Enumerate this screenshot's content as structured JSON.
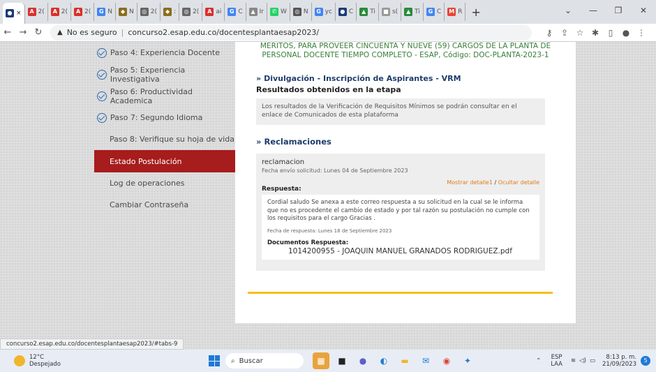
{
  "browser": {
    "tabs": [
      "2(",
      "2(",
      "2(",
      "N",
      "N",
      "2(",
      ":",
      "2(",
      "ai",
      "C",
      "Ir",
      "W",
      "N",
      "yc",
      "C",
      "Ti",
      "s(",
      "Ti",
      "C",
      "R"
    ],
    "new_tab": "+",
    "address": {
      "security": "No es seguro",
      "url": "concurso2.esap.edu.co/docentesplantaesap2023/"
    }
  },
  "sidebar": {
    "items": [
      {
        "label": "Paso 4: Experiencia Docente",
        "done": true
      },
      {
        "label": "Paso 5: Experiencia Investigativa",
        "done": true
      },
      {
        "label": "Paso 6: Productividad Academica",
        "done": true
      },
      {
        "label": "Paso 7: Segundo Idioma",
        "done": true
      },
      {
        "label": "Paso 8: Verifique su hoja de vida",
        "done": false
      },
      {
        "label": "Estado Postulación",
        "done": false,
        "active": true
      },
      {
        "label": "Log de operaciones",
        "done": false
      },
      {
        "label": "Cambiar Contraseña",
        "done": false
      }
    ]
  },
  "main": {
    "intro_line1": "MERITOS, PARA PROVEER CINCUENTA Y NUEVE (59) CARGOS DE LA PLANTA DE",
    "intro_line2": "PERSONAL DOCENTE TIEMPO COMPLETO - ESAP, Código: DOC-PLANTA-2023-1",
    "divulgacion_title": "Divulgación - Inscripción de Aspirantes - VRM",
    "resultados_title": "Resultados obtenidos en la etapa",
    "resultados_text": "Los resultados de la Verificación de Requisitos Mínimos se podrán consultar en el enlace de Comunicados de esta plataforma",
    "reclamaciones_title": "Reclamaciones",
    "reclamacion": {
      "name": "reclamacion",
      "date": "Fecha envío solicitud:  Lunes 04 de Septiembre 2023",
      "show_detail": "Mostrar detalle1",
      "separator": "/",
      "hide_detail": "Ocultar detalle",
      "response_label": "Respuesta:",
      "response_text": "Cordial saludo Se anexa a este correo respuesta a su solicitud en la cual se le informa que no es procedente el cambio de estado y por tal razón su postulación no cumple con los requisitos para el cargo Gracias .",
      "response_date": "Fecha de respuesta:  Lunes 18 de Septiembre 2023",
      "docs_label": "Documentos Respuesta:",
      "doc_file": "1014200955 - JOAQUIN MANUEL GRANADOS RODRIGUEZ.pdf"
    }
  },
  "status_url": "concurso2.esap.edu.co/docentesplantaesap2023/#tabs-9",
  "taskbar": {
    "temp": "12°C",
    "weather": "Despejado",
    "search": "Buscar",
    "lang1": "ESP",
    "lang2": "LAA",
    "time": "8:13 p. m.",
    "date": "21/09/2023",
    "notif": "5"
  },
  "colors": {
    "active_item": "#a71c1c",
    "intro_green": "#3a7d3a",
    "section_blue": "#1e3d6b",
    "link_orange": "#e07b1a",
    "footer_line": "#f2c10f"
  }
}
